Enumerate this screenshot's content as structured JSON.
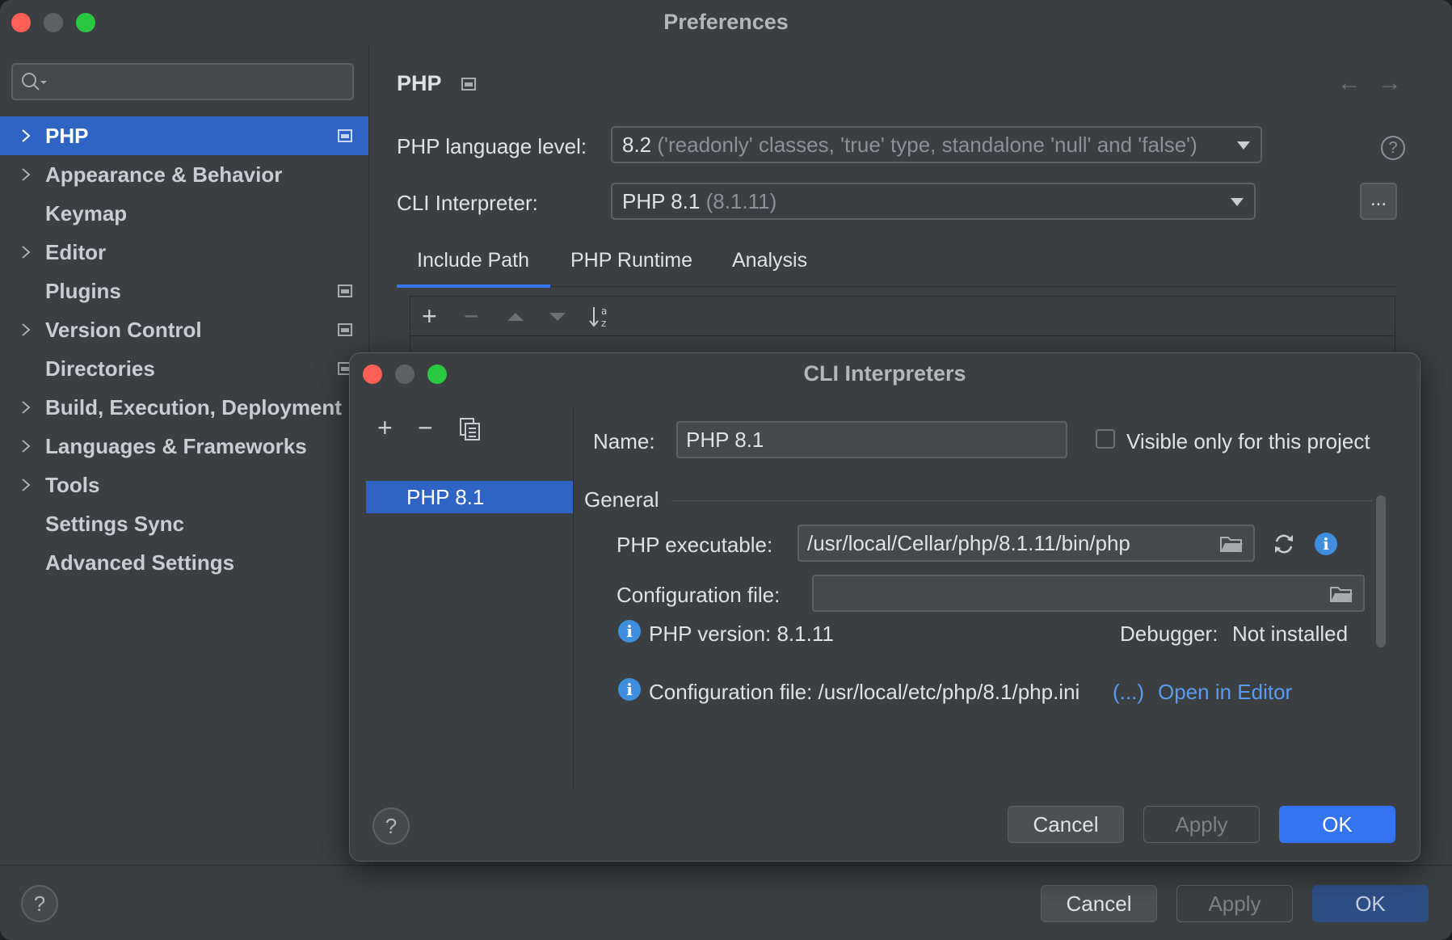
{
  "window": {
    "title": "Preferences"
  },
  "sidebar": {
    "search_placeholder": "",
    "items": [
      {
        "label": "PHP",
        "expandable": true,
        "badge": true,
        "selected": true
      },
      {
        "label": "Appearance & Behavior",
        "expandable": true,
        "badge": false
      },
      {
        "label": "Keymap",
        "expandable": false,
        "badge": false
      },
      {
        "label": "Editor",
        "expandable": true,
        "badge": false
      },
      {
        "label": "Plugins",
        "expandable": false,
        "badge": true
      },
      {
        "label": "Version Control",
        "expandable": true,
        "badge": true
      },
      {
        "label": "Directories",
        "expandable": false,
        "badge": true
      },
      {
        "label": "Build, Execution, Deployment",
        "expandable": true,
        "badge": false
      },
      {
        "label": "Languages & Frameworks",
        "expandable": true,
        "badge": false
      },
      {
        "label": "Tools",
        "expandable": true,
        "badge": false
      },
      {
        "label": "Settings Sync",
        "expandable": false,
        "badge": false
      },
      {
        "label": "Advanced Settings",
        "expandable": false,
        "badge": false
      }
    ]
  },
  "main": {
    "title": "PHP",
    "language_level_label": "PHP language level:",
    "language_level_value": "8.2",
    "language_level_desc": "('readonly' classes, 'true' type, standalone 'null' and 'false')",
    "cli_label": "CLI Interpreter:",
    "cli_value": "PHP 8.1",
    "cli_version": "(8.1.11)",
    "cli_more": "...",
    "tabs": [
      {
        "label": "Include Path",
        "active": true
      },
      {
        "label": "PHP Runtime",
        "active": false
      },
      {
        "label": "Analysis",
        "active": false
      }
    ]
  },
  "footer": {
    "cancel": "Cancel",
    "apply": "Apply",
    "ok": "OK",
    "help": "?"
  },
  "dialog": {
    "title": "CLI Interpreters",
    "interpreters": [
      "PHP 8.1"
    ],
    "name_label": "Name:",
    "name_value": "PHP 8.1",
    "visible_only_label": "Visible only for this project",
    "visible_only_checked": false,
    "general_label": "General",
    "executable_label": "PHP executable:",
    "executable_value": "/usr/local/Cellar/php/8.1.11/bin/php",
    "config_label": "Configuration file:",
    "config_value": "",
    "php_version_text": "PHP version: 8.1.11",
    "debugger_label": "Debugger:",
    "debugger_value": "Not installed",
    "config_file_text": "Configuration file: /usr/local/etc/php/8.1/php.ini",
    "config_more_link": "(...)",
    "open_in_editor_link": "Open in Editor",
    "cancel": "Cancel",
    "apply": "Apply",
    "ok": "OK",
    "help": "?"
  },
  "colors": {
    "accent": "#3574f0",
    "selection": "#2f64c4",
    "background": "#3c3f41",
    "link": "#5a9bf0",
    "info": "#3f8fe0"
  }
}
